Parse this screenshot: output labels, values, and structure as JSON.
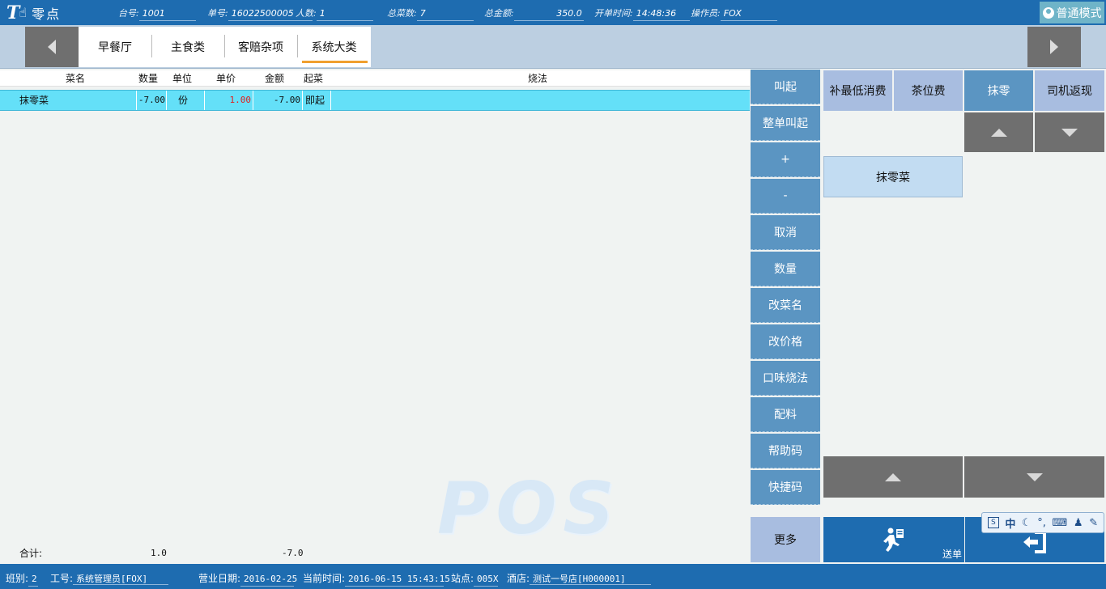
{
  "header": {
    "logo_mark": "T",
    "app_title": "零点",
    "table_label": "台号:",
    "table_no": "1001",
    "order_label": "单号:",
    "order_no": "16022500005",
    "guests_label": "人数:",
    "guests": "1",
    "total_items_label": "总菜数:",
    "total_items": "7",
    "total_amount_label": "总金额:",
    "total_amount": "350.0",
    "open_time_label": "开单时间:",
    "open_time": "14:48:36",
    "operator_label": "操作员:",
    "operator": "FOX",
    "mode_button": "普通模式"
  },
  "categories": [
    {
      "label": "早餐厅"
    },
    {
      "label": "主食类"
    },
    {
      "label": "客赔杂项"
    },
    {
      "label": "系统大类"
    }
  ],
  "table": {
    "columns": {
      "name": "菜名",
      "qty": "数量",
      "unit": "单位",
      "price": "单价",
      "amount": "金额",
      "serve": "起菜",
      "method": "烧法"
    },
    "rows": [
      {
        "name": "抹零菜",
        "qty": "-7.00",
        "unit": "份",
        "price": "1.00",
        "amount": "-7.00",
        "serve": "即起"
      }
    ],
    "total_label": "合计:",
    "total_qty": "1.0",
    "total_amount": "-7.0",
    "watermark": "POS"
  },
  "actions": [
    "叫起",
    "整单叫起",
    "+",
    "-",
    "取消",
    "数量",
    "改菜名",
    "改价格",
    "口味烧法",
    "配料",
    "帮助码",
    "快捷码"
  ],
  "more_button": "更多",
  "right_panel": {
    "top_buttons": [
      "补最低消费",
      "茶位费",
      "抹零",
      "司机返现"
    ],
    "dish_button": "抹零菜",
    "send_label": "送单"
  },
  "ime_bar": {
    "lang": "中"
  },
  "footer": {
    "shift_label": "班别:",
    "shift": "2",
    "staff_label": "工号:",
    "staff": "系统管理员[FOX]",
    "biz_date_label": "营业日期:",
    "biz_date": "2016-02-25",
    "now_label": "当前时间:",
    "now": "2016-06-15 15:43:15",
    "station_label": "站点:",
    "station": "005X",
    "store_label": "酒店:",
    "store": "测试一号店[H000001]"
  },
  "colors": {
    "header_blue": "#1e6cb0",
    "row_highlight": "#64e0f8",
    "action_blue": "#5b95c2",
    "tab_underline": "#f0a030"
  }
}
